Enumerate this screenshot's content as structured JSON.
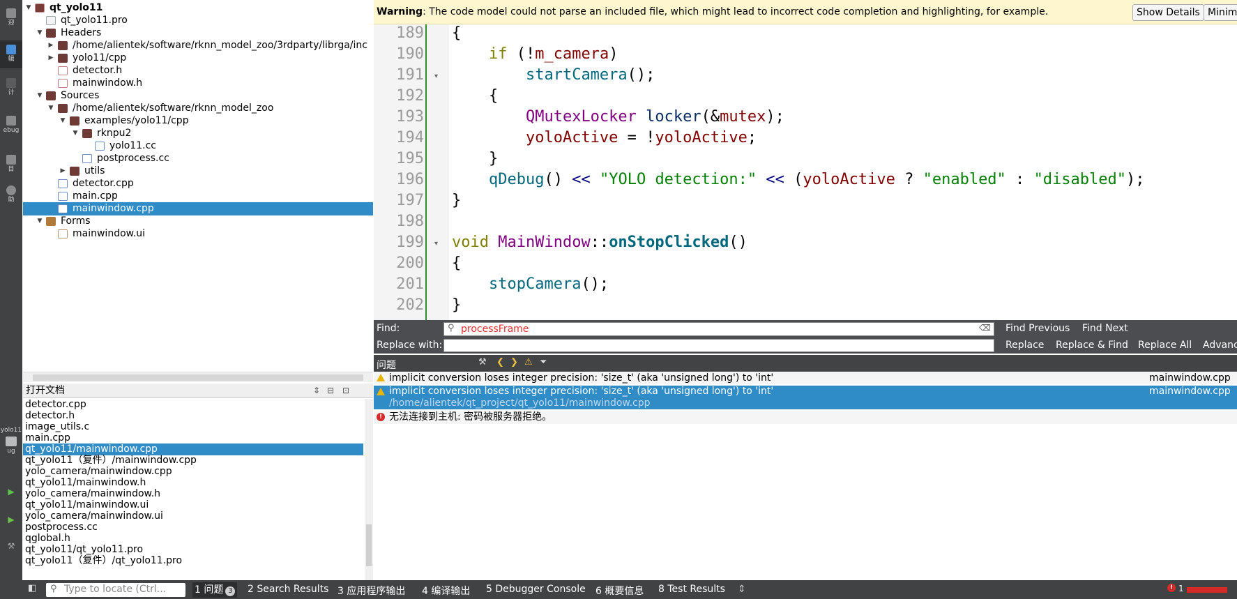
{
  "modebar": {
    "items": [
      {
        "label": "迎"
      },
      {
        "label": "辑"
      },
      {
        "label": "计"
      },
      {
        "label": "ebug"
      },
      {
        "label": "目"
      },
      {
        "label": "助"
      }
    ],
    "kit_label": "yolo11",
    "kit_sub": "ug"
  },
  "tree": {
    "items": [
      {
        "label": "qt_yolo11"
      },
      {
        "label": "qt_yolo11.pro"
      },
      {
        "label": "Headers"
      },
      {
        "label": "/home/alientek/software/rknn_model_zoo/3rdparty/librga/inc"
      },
      {
        "label": "yolo11/cpp"
      },
      {
        "label": "detector.h"
      },
      {
        "label": "mainwindow.h"
      },
      {
        "label": "Sources"
      },
      {
        "label": "/home/alientek/software/rknn_model_zoo"
      },
      {
        "label": "examples/yolo11/cpp"
      },
      {
        "label": "rknpu2"
      },
      {
        "label": "yolo11.cc"
      },
      {
        "label": "postprocess.cc"
      },
      {
        "label": "utils"
      },
      {
        "label": "detector.cpp"
      },
      {
        "label": "main.cpp"
      },
      {
        "label": "mainwindow.cpp"
      },
      {
        "label": "Forms"
      },
      {
        "label": "mainwindow.ui"
      }
    ]
  },
  "opendocs": {
    "title": "打开文档",
    "items": [
      "detector.cpp",
      "detector.h",
      "image_utils.c",
      "main.cpp",
      "qt_yolo11/mainwindow.cpp",
      "qt_yolo11（复件）/mainwindow.cpp",
      "yolo_camera/mainwindow.cpp",
      "qt_yolo11/mainwindow.h",
      "yolo_camera/mainwindow.h",
      "qt_yolo11/mainwindow.ui",
      "yolo_camera/mainwindow.ui",
      "postprocess.cc",
      "qglobal.h",
      "qt_yolo11/qt_yolo11.pro",
      "qt_yolo11（复件）/qt_yolo11.pro"
    ]
  },
  "warning": {
    "label": "Warning",
    "message": ": The code model could not parse an included file, which might lead to incorrect code completion and highlighting, for example.",
    "show_details": "Show Details",
    "minimize": "Minim"
  },
  "editor": {
    "line_numbers": [
      "189",
      "190",
      "191",
      "192",
      "193",
      "194",
      "195",
      "196",
      "197",
      "198",
      "199",
      "200",
      "201",
      "202"
    ]
  },
  "find": {
    "find_label": "Find:",
    "find_value": "processFrame",
    "replace_label": "Replace with:",
    "replace_value": "",
    "find_previous": "Find Previous",
    "find_next": "Find Next",
    "replace": "Replace",
    "replace_find": "Replace & Find",
    "replace_all": "Replace All",
    "advanced": "Advanc"
  },
  "issues": {
    "title": "问题",
    "rows": [
      {
        "text": "implicit conversion loses integer precision: 'size_t' (aka 'unsigned long') to 'int'",
        "file": "mainwindow.cpp"
      },
      {
        "text": "implicit conversion loses integer precision: 'size_t' (aka 'unsigned long') to 'int'",
        "file": "mainwindow.cpp",
        "path": "/home/alientek/qt_project/qt_yolo11/mainwindow.cpp"
      },
      {
        "text": "无法连接到主机: 密码被服务器拒绝。",
        "file": ""
      }
    ]
  },
  "statusbar": {
    "locate_placeholder": "Type to locate (Ctrl...",
    "tabs": [
      {
        "num": "1",
        "label": "问题",
        "badge": "3"
      },
      {
        "num": "2",
        "label": "Search Results"
      },
      {
        "num": "3",
        "label": "应用程序输出"
      },
      {
        "num": "4",
        "label": "编译输出"
      },
      {
        "num": "5",
        "label": "Debugger Console"
      },
      {
        "num": "6",
        "label": "概要信息"
      },
      {
        "num": "8",
        "label": "Test Results"
      }
    ],
    "error_count": "1"
  }
}
